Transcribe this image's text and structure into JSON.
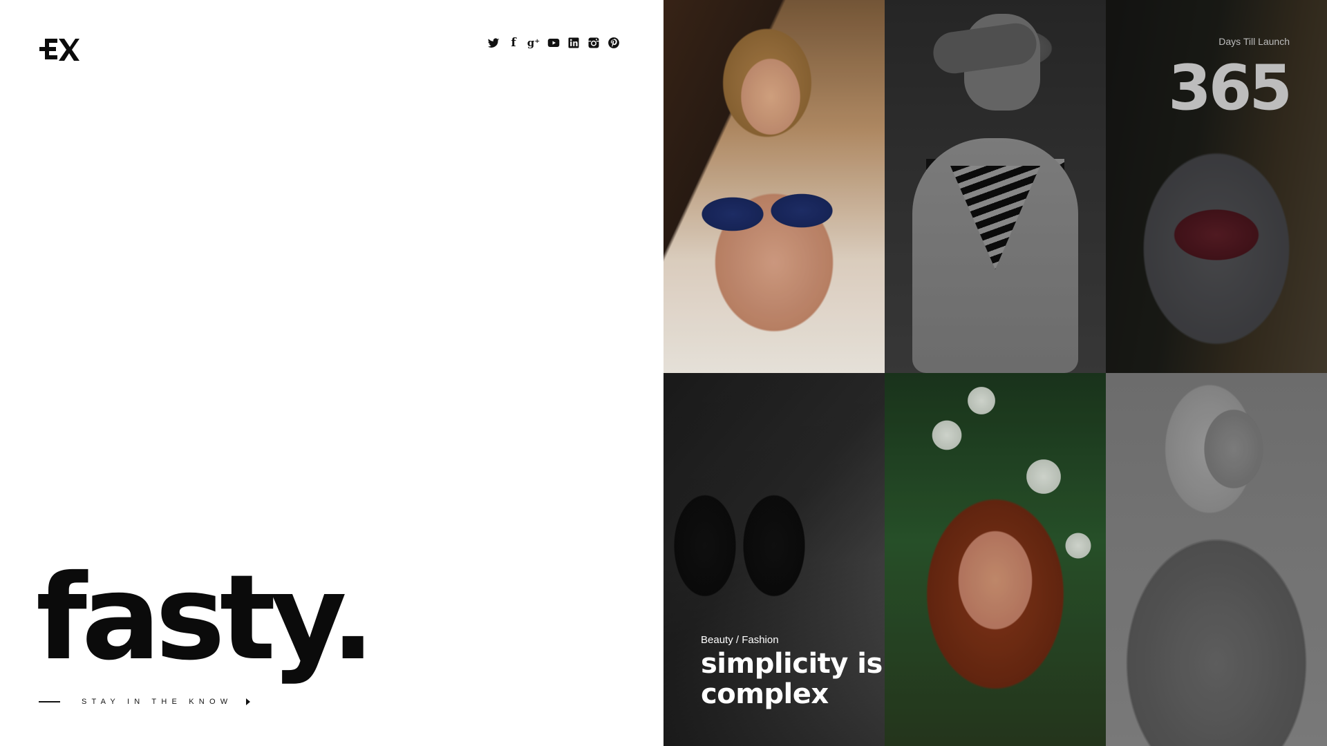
{
  "brand": {
    "logo_text": "EX",
    "name": "fasty."
  },
  "social": [
    {
      "name": "twitter",
      "glyph": ""
    },
    {
      "name": "facebook",
      "glyph": "f"
    },
    {
      "name": "google-plus",
      "glyph": "g⁺"
    },
    {
      "name": "youtube",
      "glyph": ""
    },
    {
      "name": "linkedin",
      "glyph": ""
    },
    {
      "name": "instagram",
      "glyph": ""
    },
    {
      "name": "pinterest",
      "glyph": ""
    }
  ],
  "cta": {
    "label": "STAY IN THE KNOW"
  },
  "countdown": {
    "label": "Days Till Launch",
    "value": "365"
  },
  "feature": {
    "category": "Beauty / Fashion",
    "title_line1": "simplicity is",
    "title_line2": "complex"
  },
  "colors": {
    "background": "#ffffff",
    "text": "#111111",
    "overlay_text": "#ffffff",
    "countdown": "#bdbdbd"
  }
}
